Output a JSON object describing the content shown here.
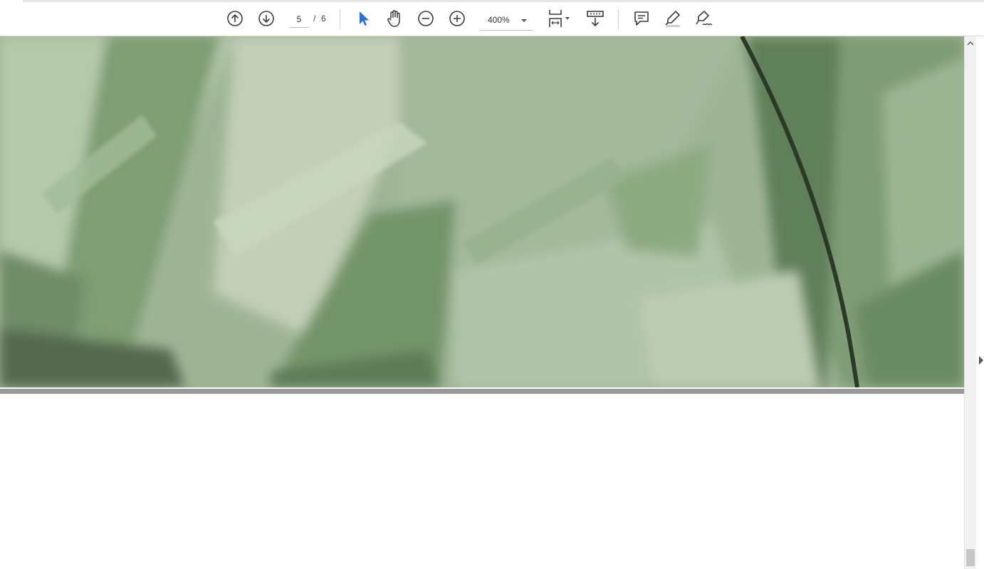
{
  "toolbar": {
    "buttons": [
      {
        "name": "previous-page",
        "icon": "arrow-up-circle-icon"
      },
      {
        "name": "next-page",
        "icon": "arrow-down-circle-icon"
      },
      {
        "name": "select-tool",
        "icon": "cursor-arrow-icon"
      },
      {
        "name": "hand-tool",
        "icon": "hand-icon"
      },
      {
        "name": "zoom-out",
        "icon": "minus-circle-icon"
      },
      {
        "name": "zoom-in",
        "icon": "plus-circle-icon"
      },
      {
        "name": "fit-page",
        "icon": "fit-page-icon"
      },
      {
        "name": "scroll-mode",
        "icon": "scroll-mode-icon"
      },
      {
        "name": "add-comment",
        "icon": "comment-icon"
      },
      {
        "name": "highlight",
        "icon": "highlighter-icon"
      },
      {
        "name": "sign",
        "icon": "signature-pen-icon"
      }
    ],
    "page_current": "5",
    "page_separator": "/",
    "page_total": "6",
    "zoom_level": "400%"
  },
  "colors": {
    "active_tool": "#2a6fdb",
    "icon": "#3c3c3c",
    "page_gap": "#9a9a9a",
    "scroll_thumb": "#c6c6c6"
  }
}
